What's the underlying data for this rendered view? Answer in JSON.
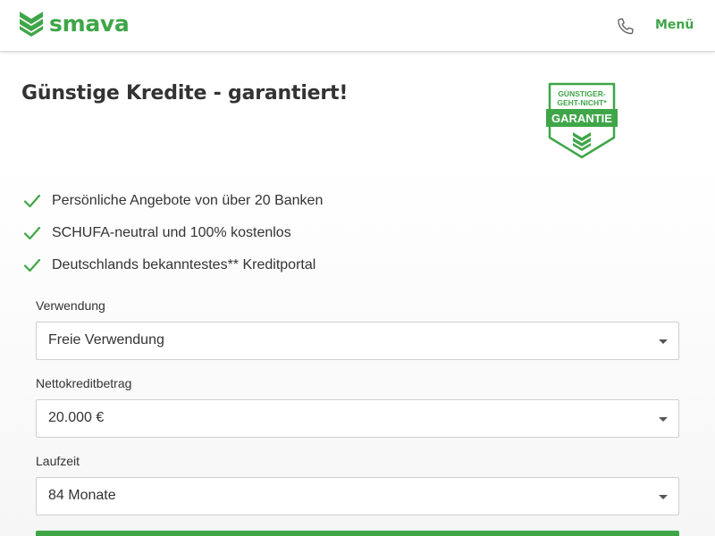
{
  "header": {
    "logo_text": "smava",
    "phone_icon": "phone-icon",
    "menu_label": "Menü"
  },
  "main": {
    "title": "Günstige Kredite - garantiert!",
    "badge": {
      "line1": "GÜNSTIGER-",
      "line2": "GEHT-NICHT*",
      "ribbon": "GARANTIE"
    },
    "features": [
      "Persönliche Angebote von über 20 Banken",
      "SCHUFA-neutral und 100% kostenlos",
      "Deutschlands bekanntestes** Kreditportal"
    ]
  },
  "form": {
    "usage": {
      "label": "Verwendung",
      "value": "Freie Verwendung"
    },
    "amount": {
      "label": "Nettokreditbetrag",
      "value": "20.000 €"
    },
    "term": {
      "label": "Laufzeit",
      "value": "84 Monate"
    }
  },
  "colors": {
    "brand_green": "#3fa648",
    "text": "#333333"
  }
}
